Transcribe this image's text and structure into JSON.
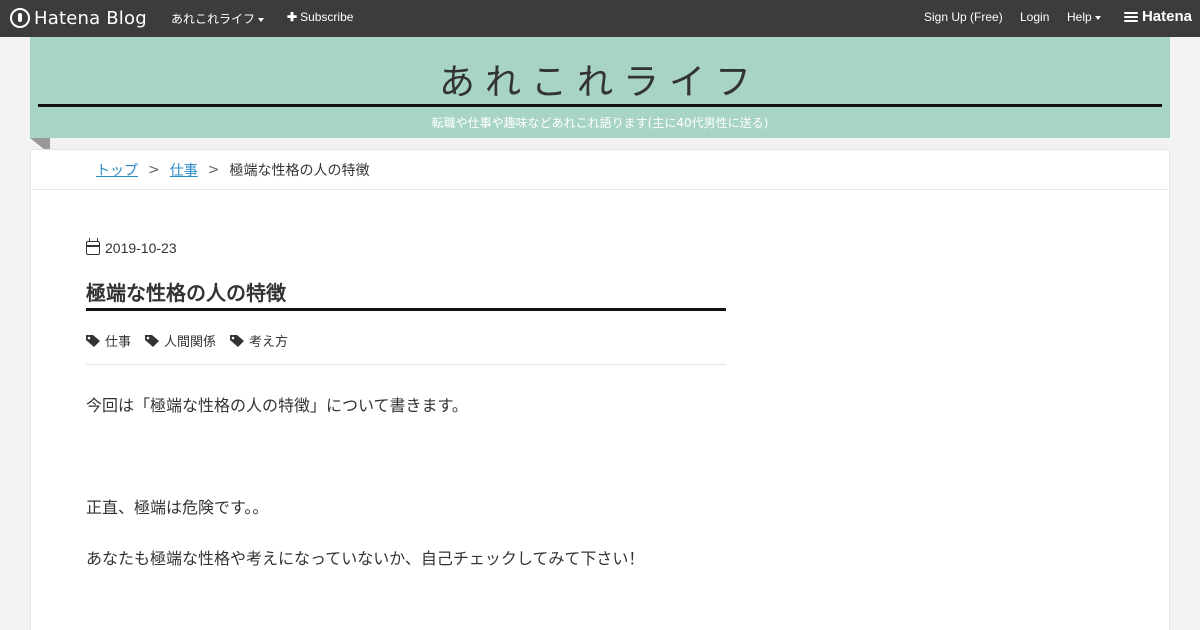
{
  "topbar": {
    "logo_text": "Hatena Blog",
    "blog_menu_label": "あれこれライフ",
    "subscribe_label": "Subscribe",
    "signup_label": "Sign Up (Free)",
    "login_label": "Login",
    "help_label": "Help",
    "hatena_label": "Hatena"
  },
  "blog": {
    "title": "あれこれライフ",
    "description": "転職や仕事や趣味などあれこれ語ります(主に40代男性に送る)",
    "header_color": "#a8d4c8"
  },
  "breadcrumb": {
    "items": [
      "トップ",
      "仕事",
      "極端な性格の人の特徴"
    ],
    "separator": ">"
  },
  "entry": {
    "date": "2019-10-23",
    "title": "極端な性格の人の特徴",
    "tags": [
      "仕事",
      "人間関係",
      "考え方"
    ],
    "paragraphs": [
      "今回は「極端な性格の人の特徴」について書きます。",
      "正直、極端は危険です。。",
      "あなたも極端な性格や考えになっていないか、自己チェックしてみて下さい！"
    ]
  },
  "colors": {
    "link": "#2c8bc7",
    "topbar": "#3c3c3c"
  },
  "icons": [
    "hatena-logo-icon",
    "caret-down-icon",
    "plus-icon",
    "calendar-icon",
    "tag-icon"
  ]
}
